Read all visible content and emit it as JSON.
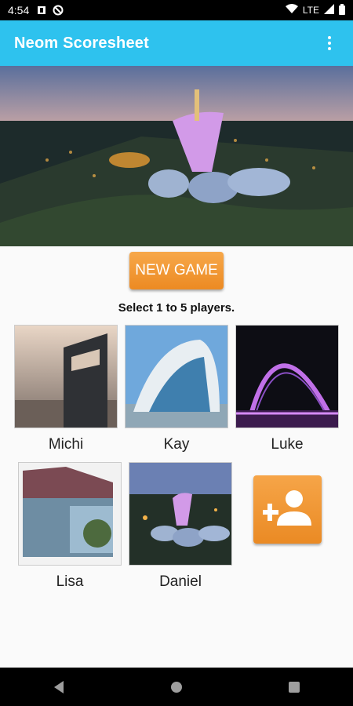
{
  "status_bar": {
    "time": "4:54",
    "network": "LTE"
  },
  "app_bar": {
    "title": "Neom Scoresheet",
    "menu_icon": "more-vert-icon"
  },
  "main": {
    "new_game_label": "NEW GAME",
    "hint": "Select 1 to 5 players.",
    "players": [
      {
        "name": "Michi"
      },
      {
        "name": "Kay"
      },
      {
        "name": "Luke"
      },
      {
        "name": "Lisa"
      },
      {
        "name": "Daniel"
      }
    ],
    "add_player_icon": "add-person-icon"
  },
  "colors": {
    "app_bar": "#2ec2ee",
    "accent": "#ec8a22"
  }
}
